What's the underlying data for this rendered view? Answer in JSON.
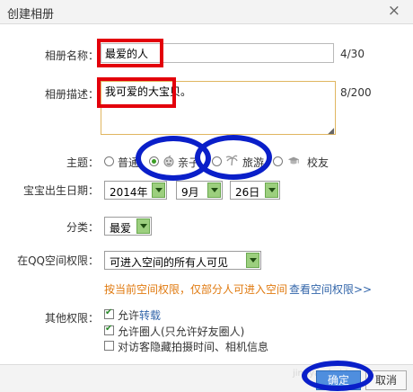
{
  "dialog": {
    "title": "创建相册"
  },
  "album_name": {
    "label": "相册名称：",
    "value": "最爱的人",
    "counter": "4/30"
  },
  "album_desc": {
    "label": "相册描述：",
    "value": "我可爱的大宝贝。",
    "counter": "8/200"
  },
  "theme": {
    "label": "主题：",
    "options": [
      {
        "label": "普通",
        "selected": false,
        "icon": "none"
      },
      {
        "label": "亲子",
        "selected": true,
        "icon": "baby-face-icon"
      },
      {
        "label": "旅游",
        "selected": false,
        "icon": "palm-tree-icon"
      },
      {
        "label": "校友",
        "selected": false,
        "icon": "graduation-cap-icon"
      }
    ]
  },
  "birthday": {
    "label": "宝宝出生日期：",
    "year": "2014年",
    "month": "9月",
    "day": "26日"
  },
  "category": {
    "label": "分类：",
    "value": "最爱"
  },
  "permission": {
    "label": "在QQ空间权限：",
    "value": "可进入空间的所有人可见",
    "hint": "按当前空间权限，仅部分人可进入空间",
    "hint_link": "查看空间权限>>"
  },
  "other": {
    "label": "其他权限：",
    "items": [
      {
        "pre": "允许",
        "em": "转载",
        "post": "",
        "checked": true
      },
      {
        "pre": "允许圈人(只允许好友圈人)",
        "em": "",
        "post": "",
        "checked": true
      },
      {
        "pre": "对访客隐藏拍摄时间、相机信息",
        "em": "",
        "post": "",
        "checked": false
      }
    ]
  },
  "footer": {
    "ok": "确定",
    "cancel": "取消",
    "watermark": "jingyan.baidu"
  },
  "colors": {
    "annotation_red": "#e3000b",
    "annotation_blue": "#0a1fc9",
    "hint_orange": "#e07a10",
    "primary_button": "#4f8ede"
  }
}
